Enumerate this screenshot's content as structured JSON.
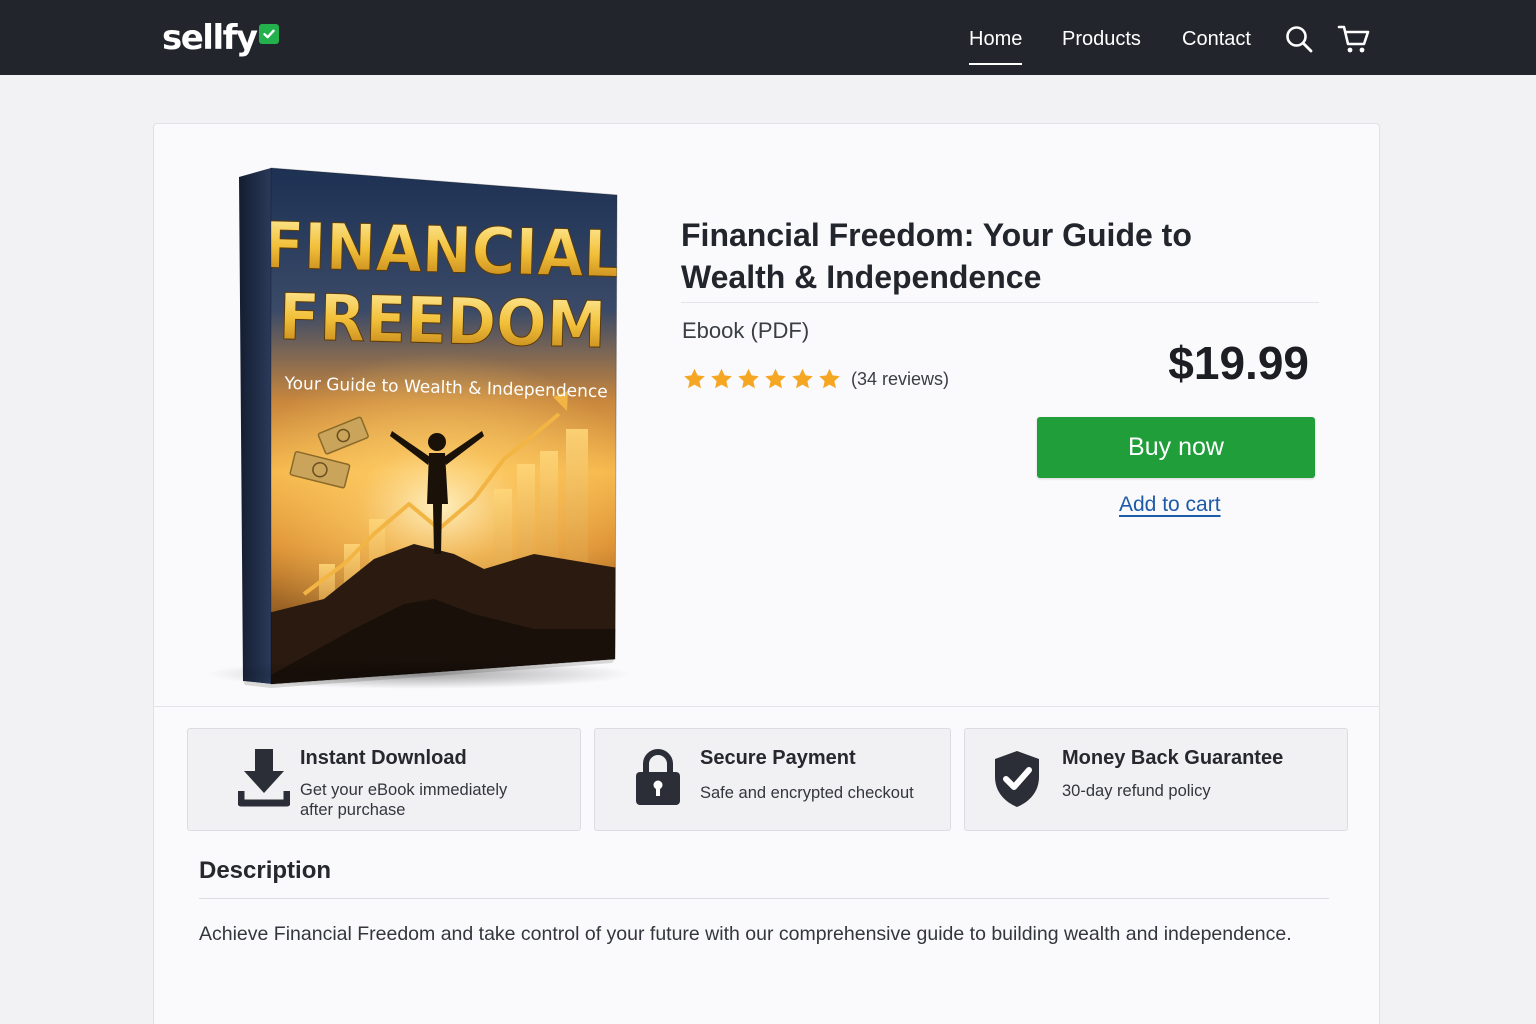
{
  "header": {
    "logo_text": "sellfy",
    "nav": {
      "home": "Home",
      "products": "Products",
      "contact": "Contact"
    },
    "active_nav": "Home"
  },
  "book_cover": {
    "title_line1": "FINANCIAL",
    "title_line2": "FREEDOM",
    "subtitle": "Your Guide to Wealth & Independence"
  },
  "product": {
    "title": "Financial Freedom: Your Guide to Wealth & Independence",
    "format": "Ebook (PDF)",
    "rating": 5,
    "reviews": "(34 reviews)",
    "price": "$19.99",
    "buy_label": "Buy now",
    "cart_label": "Add to cart"
  },
  "features": [
    {
      "title": "Instant Download",
      "text_line1": "Get your eBook immediately",
      "text_line2": "after purchase",
      "icon": "download-icon"
    },
    {
      "title": "Secure Payment",
      "text_line1": "Safe and encrypted checkout",
      "icon": "lock-icon"
    },
    {
      "title": "Money Back Guarantee",
      "text_line1": "30-day refund policy",
      "icon": "shield-check-icon"
    }
  ],
  "description": {
    "heading": "Description",
    "text": "Achieve Financial Freedom and take control of your future with our comprehensive guide to building wealth and independence."
  },
  "colors": {
    "topbar": "#22252c",
    "brand_green": "#22b14c",
    "buy_button": "#1f9e3a",
    "link_blue": "#1d5aa8",
    "star": "#f5a623"
  }
}
